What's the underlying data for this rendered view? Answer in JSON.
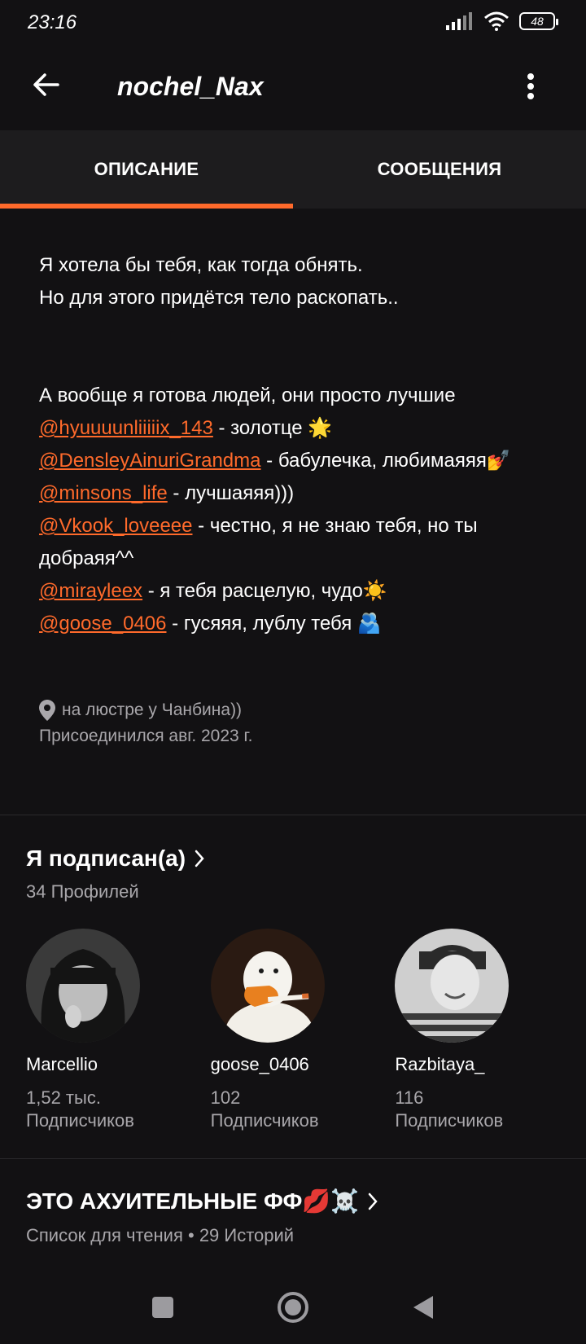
{
  "status": {
    "time": "23:16",
    "battery": "48"
  },
  "header": {
    "title": "nochel_Nax"
  },
  "tabs": [
    {
      "label": "ОПИСАНИЕ",
      "active": true
    },
    {
      "label": "СООБЩЕНИЯ",
      "active": false
    }
  ],
  "description": {
    "line1": "Я хотела бы тебя, как тогда обнять.",
    "line2": "Но для этого придётся тело раскопать..",
    "line3": "А вообще я готова людей, они просто лучшие",
    "mentions": [
      {
        "handle": "@hyuuuunliiiiix_143",
        "text": " - золотце 🌟"
      },
      {
        "handle": "@DensleyAinuriGrandma",
        "text": " - бабулечка, любимаяяя💅"
      },
      {
        "handle": "@minsons_life",
        "text": " - лучшаяяя)))"
      },
      {
        "handle": "@Vkook_loveeee",
        "text": " - честно, я не знаю тебя, но ты добраяя^^"
      },
      {
        "handle": "@mirayleex",
        "text": " - я тебя расцелую, чудо☀️"
      },
      {
        "handle": "@goose_0406",
        "text": " - гусяяя, лублу тебя 🫂"
      }
    ],
    "location": "на люстре у Чанбина))",
    "joined": "Присоединился авг. 2023 г."
  },
  "following": {
    "title": "Я подписан(а)",
    "subtitle": "34 Профилей",
    "profiles": [
      {
        "name": "Marcellio",
        "count": "1,52 тыс.",
        "label": "Подписчиков"
      },
      {
        "name": "goose_0406",
        "count": "102",
        "label": "Подписчиков"
      },
      {
        "name": "Razbitaya_",
        "count": "116",
        "label": "Подписчиков"
      }
    ]
  },
  "reading_list": {
    "title": "ЭТО АХУИТЕЛЬНЫЕ ФФ💋☠️",
    "subtitle": "Список для чтения • 29 Историй"
  },
  "colors": {
    "accent": "#ff6a2b",
    "background": "#121113",
    "tab_bg": "#1d1c1e",
    "muted": "#a9a7ab"
  }
}
